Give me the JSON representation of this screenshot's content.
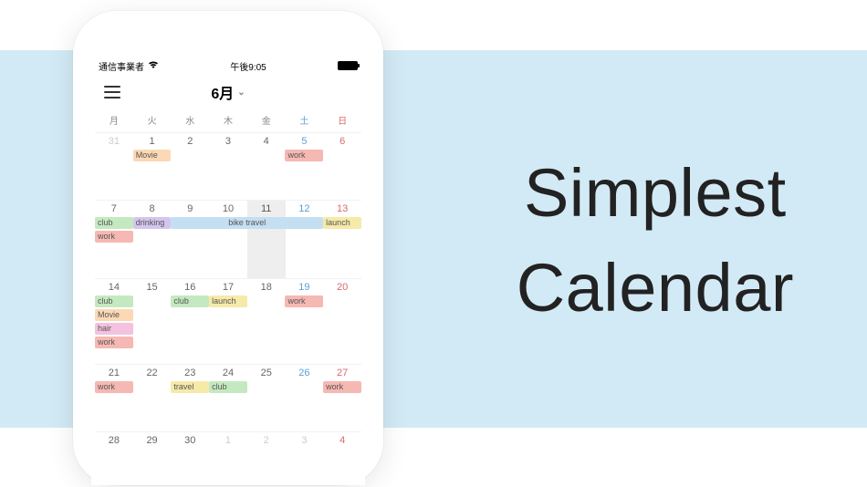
{
  "marketing": {
    "headline_line1": "Simplest",
    "headline_line2": "Calendar"
  },
  "status_bar": {
    "carrier": "通信事業者",
    "time": "午後9:05"
  },
  "header": {
    "month_label": "6月"
  },
  "weekdays": {
    "mon": "月",
    "tue": "火",
    "wed": "水",
    "thu": "木",
    "fri": "金",
    "sat": "土",
    "sun": "日"
  },
  "days": {
    "w1": {
      "d1": "31",
      "d2": "1",
      "d3": "2",
      "d4": "3",
      "d5": "4",
      "d6": "5",
      "d7": "6"
    },
    "w2": {
      "d1": "7",
      "d2": "8",
      "d3": "9",
      "d4": "10",
      "d5": "11",
      "d6": "12",
      "d7": "13"
    },
    "w3": {
      "d1": "14",
      "d2": "15",
      "d3": "16",
      "d4": "17",
      "d5": "18",
      "d6": "19",
      "d7": "20"
    },
    "w4": {
      "d1": "21",
      "d2": "22",
      "d3": "23",
      "d4": "24",
      "d5": "25",
      "d6": "26",
      "d7": "27"
    },
    "w5": {
      "d1": "28",
      "d2": "29",
      "d3": "30",
      "d4": "1",
      "d5": "2",
      "d6": "3",
      "d7": "4"
    }
  },
  "events": {
    "w1_movie": "Movie",
    "w1_work": "work",
    "w2_club": "club",
    "w2_drink": "drinking",
    "w2_bike": "bike travel",
    "w2_launch": "launch",
    "w2_work": "work",
    "w3_club": "club",
    "w3_movie": "Movie",
    "w3_club2": "club",
    "w3_launch": "launch",
    "w3_work": "work",
    "w3_hair": "hair",
    "w3_work2": "work",
    "w4_work": "work",
    "w4_travel": "travel",
    "w4_club": "club",
    "w4_work2": "work"
  },
  "colors": {
    "band": "#d2eaf5",
    "orange": "#fcd9b4",
    "red": "#f6b8b3",
    "green": "#c4e9c0",
    "purple": "#d4c5ee",
    "yellow": "#f6eaa9",
    "pink": "#f4c2e0",
    "blue": "#c4dff1"
  }
}
